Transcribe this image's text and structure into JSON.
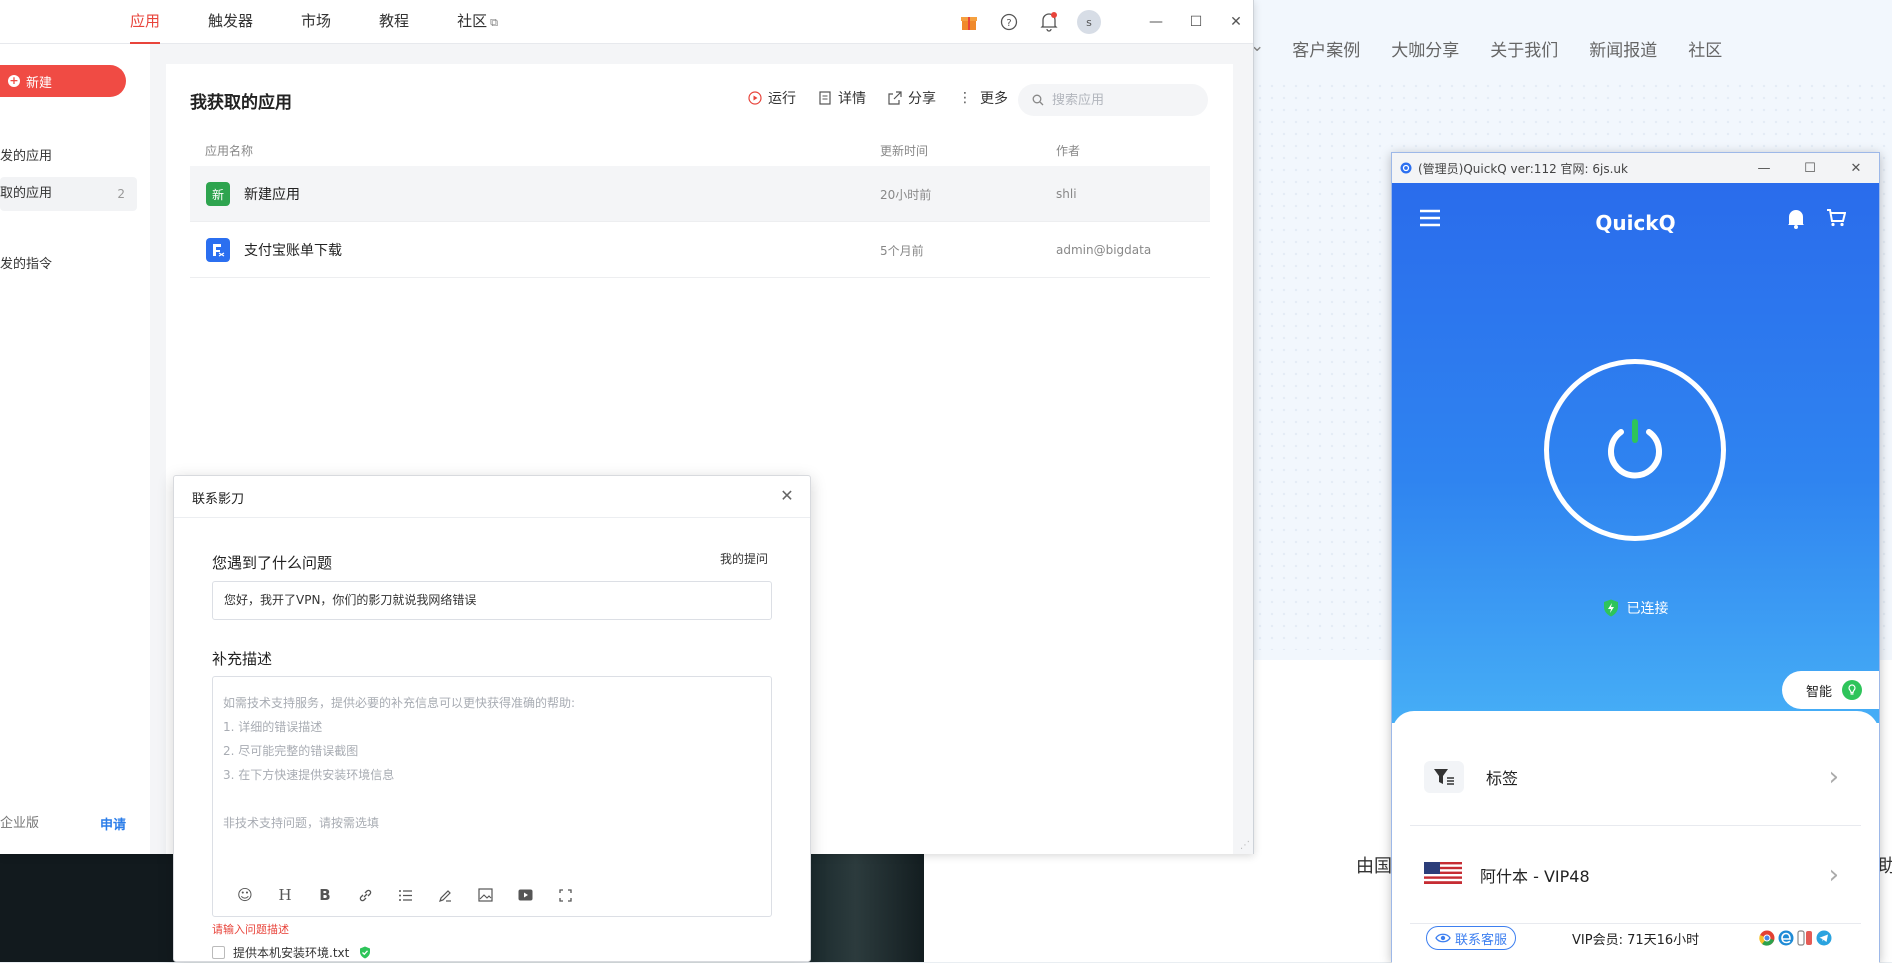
{
  "app": {
    "tabs": [
      {
        "label": "应用",
        "active": true
      },
      {
        "label": "触发器",
        "active": false
      },
      {
        "label": "市场",
        "active": false
      },
      {
        "label": "教程",
        "active": false
      },
      {
        "label": "社区",
        "active": false,
        "external": true
      }
    ],
    "avatar_initial": "s",
    "new_button": "新建",
    "sidebar": {
      "items": [
        {
          "label": "发的应用",
          "selected": false
        },
        {
          "label": "取的应用",
          "selected": true,
          "count": "2"
        },
        {
          "label": "发的指令",
          "selected": false
        }
      ],
      "edition": "企业版",
      "apply": "申请"
    },
    "main": {
      "title": "我获取的应用",
      "toolbar": {
        "run": "运行",
        "details": "详情",
        "share": "分享",
        "more": "更多"
      },
      "search_placeholder": "搜索应用",
      "columns": [
        "应用名称",
        "更新时间",
        "作者"
      ],
      "rows": [
        {
          "icon_text": "新",
          "icon_color": "#2ea44f",
          "name": "新建应用",
          "updated": "20小时前",
          "author": "shli"
        },
        {
          "icon_text": "",
          "icon_color": "#2b6ff0",
          "name": "支付宝账单下载",
          "updated": "5个月前",
          "author": "admin@bigdata"
        }
      ]
    }
  },
  "dialog": {
    "title": "联系影刀",
    "question_label": "您遇到了什么问题",
    "my_questions": "我的提问",
    "question_value": "您好，我开了VPN，你们的影刀就说我网络错误",
    "desc_label": "补充描述",
    "desc_placeholder": "如需技术支持服务，提供必要的补充信息可以更快获得准确的帮助:\n1. 详细的错误描述\n2. 尽可能完整的错误截图\n3. 在下方快速提供安装环境信息\n\n非技术支持问题，请按需选填",
    "error": "请输入问题描述",
    "checkbox_label": "提供本机安装环境.txt"
  },
  "background_site": {
    "nav": [
      "客户案例",
      "大咖分享",
      "关于我们",
      "新闻报道",
      "社区"
    ],
    "fragment_left": "由国",
    "fragment_right": "助"
  },
  "quickq": {
    "title": "(管理员)QuickQ ver:112  官网: 6js.uk",
    "brand": "QuickQ",
    "status": "已连接",
    "mode": "智能",
    "tag_row": "标签",
    "server_row": "阿什本 - VIP48",
    "support": "联系客服",
    "vip": "VIP会员: 71天16小时",
    "colors": {
      "hero_top": "#2a6cec",
      "hero_bottom": "#46aef6",
      "connected": "#2ec45a"
    }
  }
}
